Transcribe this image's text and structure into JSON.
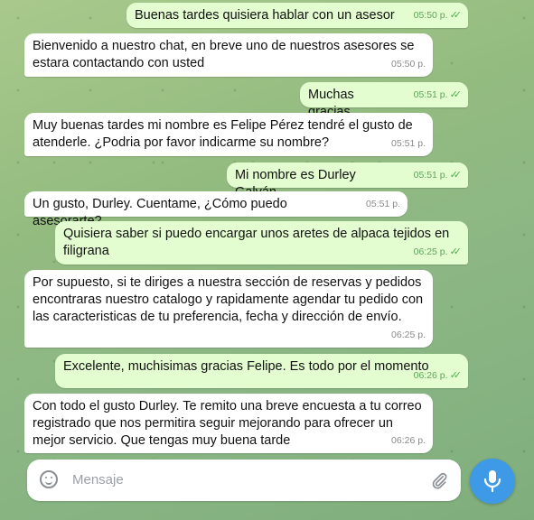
{
  "messages": [
    {
      "dir": "out",
      "text": "Buenas tardes quisiera hablar con un asesor",
      "time": "05:50 p."
    },
    {
      "dir": "in",
      "text": "Bienvenido a nuestro chat, en breve uno de nuestros asesores se estara contactando con usted",
      "time": "05:50 p."
    },
    {
      "dir": "out",
      "text": "Muchas gracias",
      "time": "05:51 p."
    },
    {
      "dir": "in",
      "text": "Muy buenas tardes mi nombre es Felipe Pérez tendré el gusto de atenderle. ¿Podria por favor indicarme su nombre?",
      "time": "05:51 p."
    },
    {
      "dir": "out",
      "text": "Mi nombre es Durley Galván",
      "time": "05:51 p."
    },
    {
      "dir": "in",
      "text": "Un gusto, Durley. Cuentame, ¿Cómo puedo asesorarte?",
      "time": "05:51 p."
    },
    {
      "dir": "out",
      "text": "Quisiera saber si puedo encargar unos aretes de alpaca tejidos en filigrana",
      "time": "06:25 p."
    },
    {
      "dir": "in",
      "text": "Por supuesto, si te diriges a nuestra sección de reservas y pedidos encontraras nuestro catalogo y rapidamente agendar tu pedido con las caracteristicas de tu preferencia, fecha y dirección de envío.",
      "time": "06:25 p."
    },
    {
      "dir": "out",
      "text": "Excelente, muchisimas gracias Felipe. Es todo por el momento",
      "time": "06:26 p."
    },
    {
      "dir": "in",
      "text": "Con todo el gusto Durley. Te remito una breve encuesta a tu correo registrado que nos permitira seguir mejorando para ofrecer un mejor servicio. Que tengas muy buena tarde",
      "time": "06:26 p."
    }
  ],
  "read_ticks": "✓✓",
  "composer": {
    "placeholder": "Mensaje"
  },
  "icons": {
    "emoji": "emoji-icon",
    "attach": "paperclip-icon",
    "mic": "microphone-icon"
  },
  "colors": {
    "incoming": "#ffffff",
    "outgoing": "#e3fdd0",
    "accent": "#3e9ae6"
  }
}
